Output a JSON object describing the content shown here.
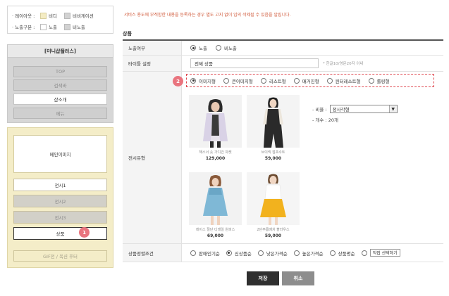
{
  "legend": {
    "layout_label": "· 레이아웃 :",
    "layout_items": [
      "비디",
      "비비게이션"
    ],
    "exposure_label": "· 노출구분 :",
    "exposure_items": [
      "노출",
      "비노출"
    ]
  },
  "mini_panel": {
    "title": "[미니샵플러스]",
    "top_buttons": [
      "TOP",
      "검색바",
      "샵소개",
      "메뉴"
    ],
    "main_image": "메인이미지",
    "bottom_buttons": [
      "전시1",
      "전시2",
      "전시3",
      "상품"
    ],
    "footer_button": "GIF전 / 옥션 푸터",
    "badge_1": "1"
  },
  "notice": "서비스 용도에 부적합한 내용을 등록하는 경우 별도 고지 없이 임의 삭제될 수 있음을 알립니다.",
  "section_title": "상품",
  "form": {
    "exposure": {
      "label": "노출여부",
      "options": [
        "노출",
        "비노출"
      ],
      "selected": 0
    },
    "title_setting": {
      "label": "타이틀 설정",
      "value": "전체 상품",
      "hint": "* 한글10/영문20자 이내"
    },
    "display_type": {
      "label": "전시유형",
      "badge": "2",
      "options": [
        "이미지형",
        "큰이미지형",
        "리스트형",
        "매거진형",
        "윈터레스트형",
        "롤링형"
      ],
      "selected": 0,
      "ratio_label": "- 비율 :",
      "ratio_value": "정사각형",
      "count_text": "- 개수 : 20개"
    },
    "sort": {
      "label": "상품정렬조건",
      "options": [
        "판매인기순",
        "신상품순",
        "낮은가격순",
        "높은가격순",
        "상품평순",
        "직접 선택하기"
      ],
      "selected": 1
    }
  },
  "products": [
    {
      "name": "해스너 숏 가디건 자켓",
      "price": "129,000"
    },
    {
      "name": "브이넥 점프수트",
      "price": "59,000"
    },
    {
      "name": "레이스 절단 디테일 원피스",
      "price": "69,000"
    },
    {
      "name": "2단주름배치 볼라우스",
      "price": "59,000"
    }
  ],
  "buttons": {
    "save": "저장",
    "cancel": "취소"
  },
  "colors": {
    "notice": "#d05a3b",
    "badge": "#e9747e",
    "highlight_border": "#e04850",
    "panel_yellow": "#f4edc8",
    "panel_gray": "#d7d7d7",
    "save_button": "#2f2f2f",
    "cancel_button": "#8d8d8d"
  }
}
